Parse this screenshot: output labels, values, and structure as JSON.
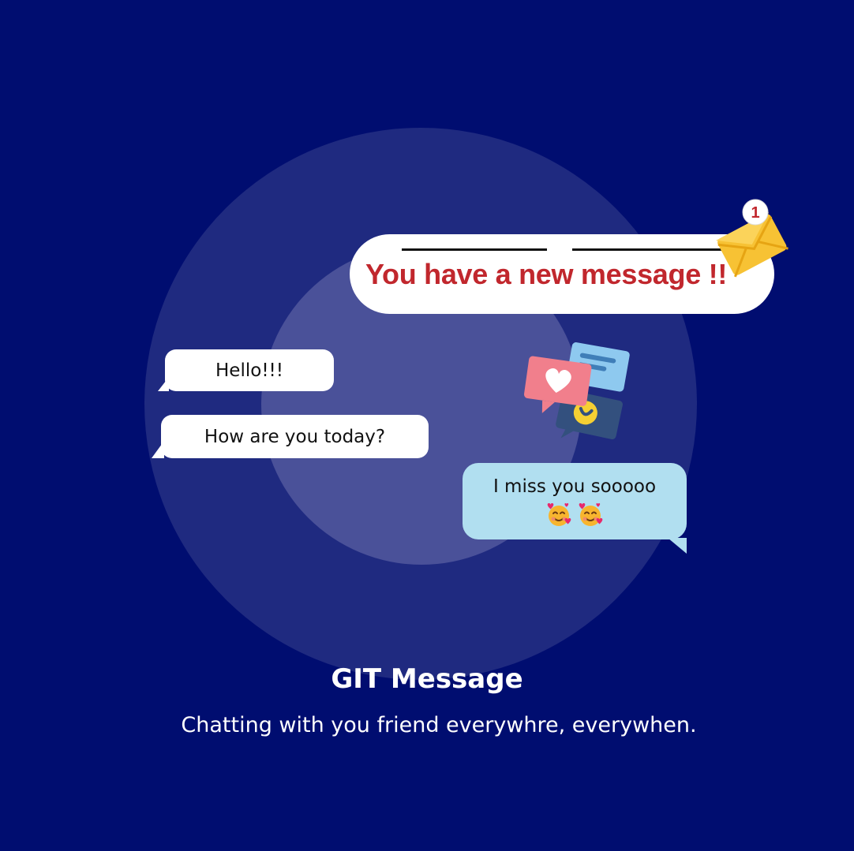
{
  "notification": {
    "text": "You have a new message !!",
    "badge_count": "1",
    "accent_color": "#c1272d"
  },
  "chat": {
    "messages": [
      {
        "text": "Hello!!!",
        "side": "incoming"
      },
      {
        "text": "How are you today?",
        "side": "incoming"
      },
      {
        "text": "I miss you sooooo",
        "side": "outgoing"
      }
    ],
    "outgoing_emojis": [
      "smiling-face-with-hearts-icon",
      "smiling-face-with-hearts-icon"
    ]
  },
  "icons": [
    "envelope-icon",
    "chat-bubbles-icon",
    "heart-icon",
    "smiling-face-with-hearts-icon"
  ],
  "footer": {
    "title": "GIT Message",
    "subtitle": "Chatting with you friend everywhre, everywhen."
  },
  "colors": {
    "background": "#000d70",
    "outgoing_bubble": "#b1dff0",
    "incoming_bubble": "#ffffff"
  }
}
